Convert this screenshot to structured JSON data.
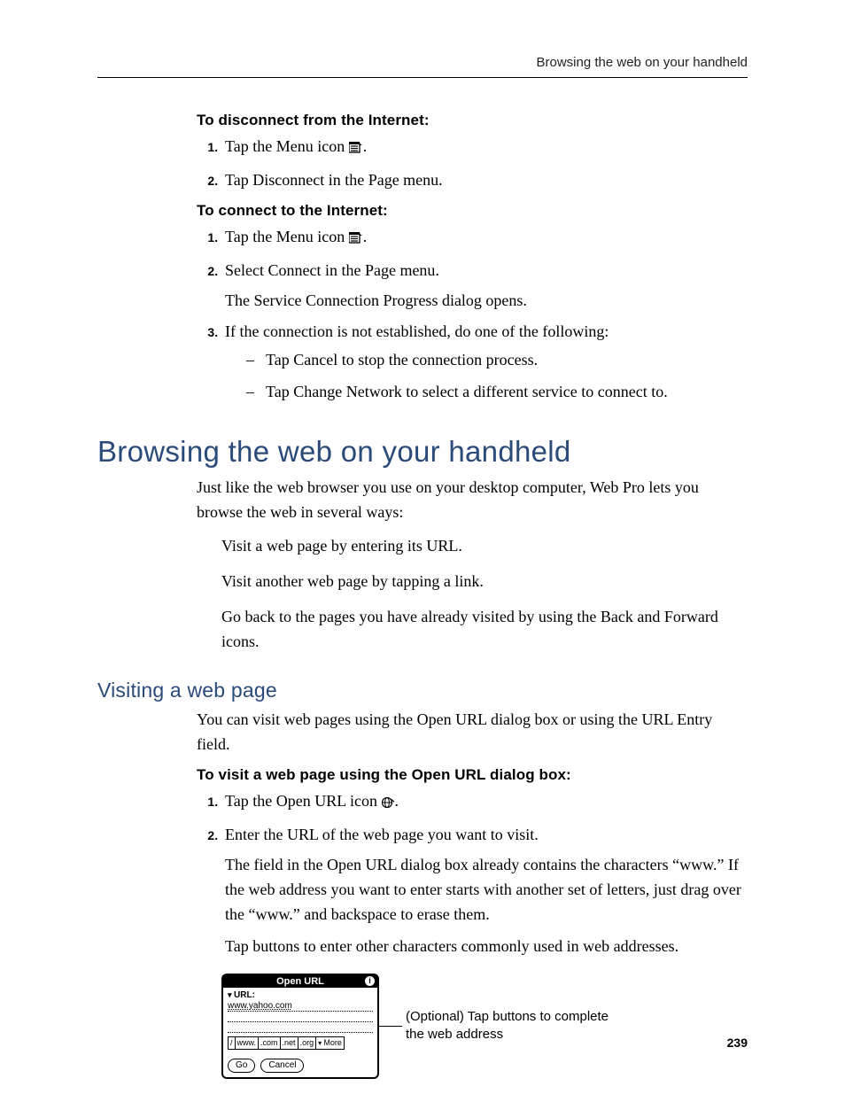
{
  "running_header": "Browsing the web on your handheld",
  "sec_disconnect": {
    "heading": "To disconnect from the Internet:",
    "step1": "Tap the Menu icon ",
    "step2": "Tap Disconnect in the Page menu."
  },
  "sec_connect": {
    "heading": "To connect to the Internet:",
    "step1": "Tap the Menu icon ",
    "step2": "Select Connect in the Page menu.",
    "step2_after": "The Service Connection Progress dialog opens.",
    "step3": "If the connection is not established, do one of the following:",
    "step3_a": "Tap Cancel to stop the connection process.",
    "step3_b": "Tap Change Network to select a different service to connect to."
  },
  "h1": "Browsing the web on your handheld",
  "intro_para": "Just like the web browser you use on your desktop computer, Web Pro lets you browse the web in several ways:",
  "intro_item1": "Visit a web page by entering its URL.",
  "intro_item2": "Visit another web page by tapping a link.",
  "intro_item3": "Go back to the pages you have already visited by using the Back and Forward icons.",
  "h2": "Visiting a web page",
  "visiting_para": "You can visit web pages using the Open URL dialog box or using the URL Entry field.",
  "sec_visit": {
    "heading": "To visit a web page using the Open URL dialog box:",
    "step1": "Tap the Open URL icon ",
    "step2": "Enter the URL of the web page you want to visit.",
    "step2_after1": "The field in the Open URL dialog box already contains the characters “www.” If the web address you want to enter starts with another set of letters, just drag over the “www.” and backspace to erase them.",
    "step2_after2": "Tap buttons to enter other characters commonly used in web addresses."
  },
  "dialog": {
    "title": "Open URL",
    "url_label": "URL:",
    "url_value": "www.yahoo.com",
    "tlds": [
      "/",
      "www.",
      ".com",
      ".net",
      ".org"
    ],
    "more": "More",
    "go": "Go",
    "cancel": "Cancel"
  },
  "callout": "(Optional) Tap buttons to complete the web address",
  "page_number": "239",
  "period": "."
}
